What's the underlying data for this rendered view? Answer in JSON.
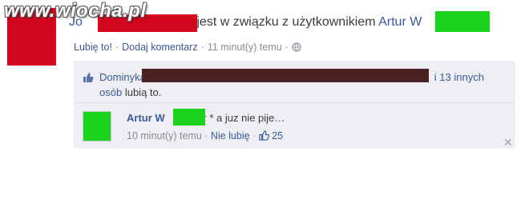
{
  "watermark": "www.wiocha.pl",
  "post": {
    "name_prefix": "Jo",
    "status_text": "jest w związku z użytkownikiem",
    "partner_name": "Artur W",
    "actions": {
      "like": "Lubię to!",
      "comment": "Dodaj komentarz",
      "time": "11 minut(y) temu",
      "sep": "·"
    }
  },
  "likes": {
    "first_name": "Dominyka",
    "suffix": "i 13 innych",
    "line2_link": "osób",
    "line2_text": "lubią to."
  },
  "comment": {
    "author": "Artur W",
    "text": "kur * a juz nie pije…",
    "time": "10 minut(y) temu",
    "unlike": "Nie lubię",
    "likes_count": "25",
    "sep": "·"
  },
  "colors": {
    "link": "#3b5998",
    "panel": "#edeff4",
    "censor_red": "#d2061f",
    "censor_green": "#19d219",
    "censor_dark": "#4a2222"
  },
  "icons": [
    "globe-icon",
    "thumbs-up-icon",
    "close-icon"
  ]
}
